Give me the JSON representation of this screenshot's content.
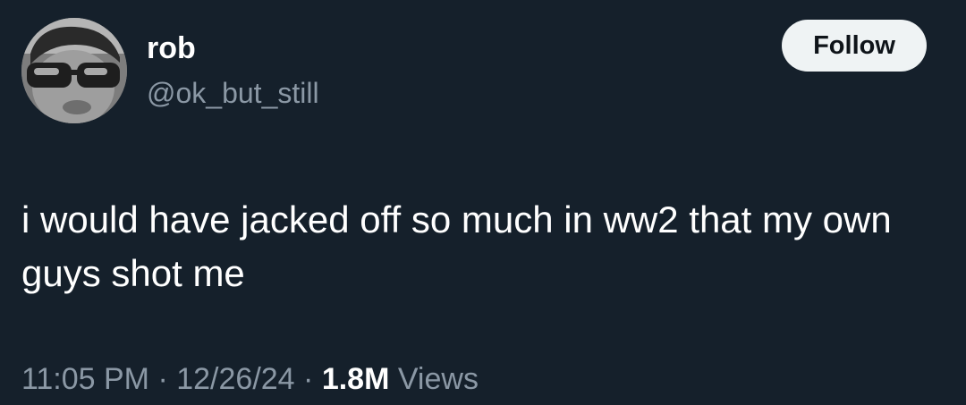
{
  "author": {
    "display_name": "rob",
    "handle": "@ok_but_still"
  },
  "follow_button": {
    "label": "Follow"
  },
  "tweet": {
    "text": "i would have jacked off so much in ww2 that my own guys shot me"
  },
  "meta": {
    "time": "11:05 PM",
    "separator": " · ",
    "date": "12/26/24",
    "views_count": "1.8M",
    "views_label": "Views"
  },
  "colors": {
    "background": "#15202b",
    "primary_text": "#ffffff",
    "secondary_text": "#8b98a5",
    "button_background": "#eff3f4",
    "button_text": "#0f1419"
  },
  "icons": {
    "avatar": "profile-photo-person-with-sunglasses"
  }
}
